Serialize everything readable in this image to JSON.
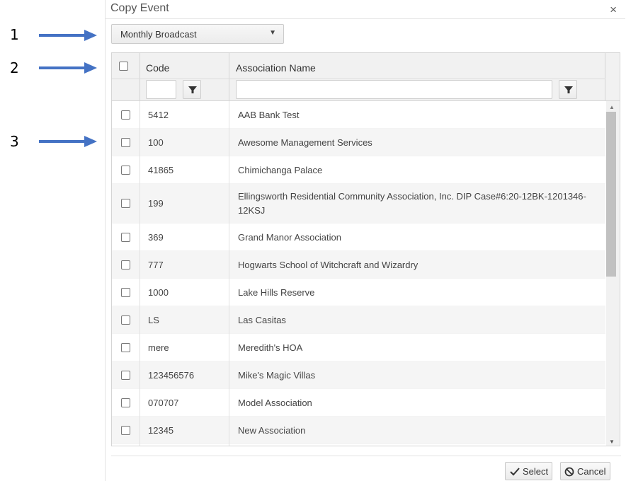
{
  "annotations": [
    {
      "number": "1"
    },
    {
      "number": "2"
    },
    {
      "number": "3"
    }
  ],
  "dialog": {
    "title": "Copy Event",
    "close_glyph": "×",
    "dropdown": {
      "selected": "Monthly Broadcast",
      "caret_glyph": "▼"
    },
    "grid": {
      "columns": [
        "Code",
        "Association Name"
      ],
      "rows": [
        {
          "code": "5412",
          "name": "AAB Bank Test"
        },
        {
          "code": "100",
          "name": "Awesome Management Services"
        },
        {
          "code": "41865",
          "name": "Chimichanga Palace"
        },
        {
          "code": "199",
          "name": "Ellingsworth Residential Community Association, Inc. DIP Case#6:20-12BK-1201346-12KSJ"
        },
        {
          "code": "369",
          "name": "Grand Manor Association"
        },
        {
          "code": "777",
          "name": "Hogwarts School of Witchcraft and Wizardry"
        },
        {
          "code": "1000",
          "name": "Lake Hills Reserve"
        },
        {
          "code": "LS",
          "name": "Las Casitas"
        },
        {
          "code": "mere",
          "name": "Meredith's HOA"
        },
        {
          "code": "123456576",
          "name": "Mike's Magic Villas"
        },
        {
          "code": "070707",
          "name": "Model Association"
        },
        {
          "code": "12345",
          "name": "New Association"
        }
      ]
    },
    "buttons": {
      "select": "Select",
      "cancel": "Cancel"
    }
  },
  "icons": [
    "arrow-icon",
    "close-icon",
    "chevron-down-icon",
    "filter-icon",
    "checkmark-icon",
    "cancel-icon"
  ],
  "colors": {
    "arrow": "#4472C4",
    "header_bg": "#f1f1f1",
    "alt_row": "#f5f5f5"
  }
}
